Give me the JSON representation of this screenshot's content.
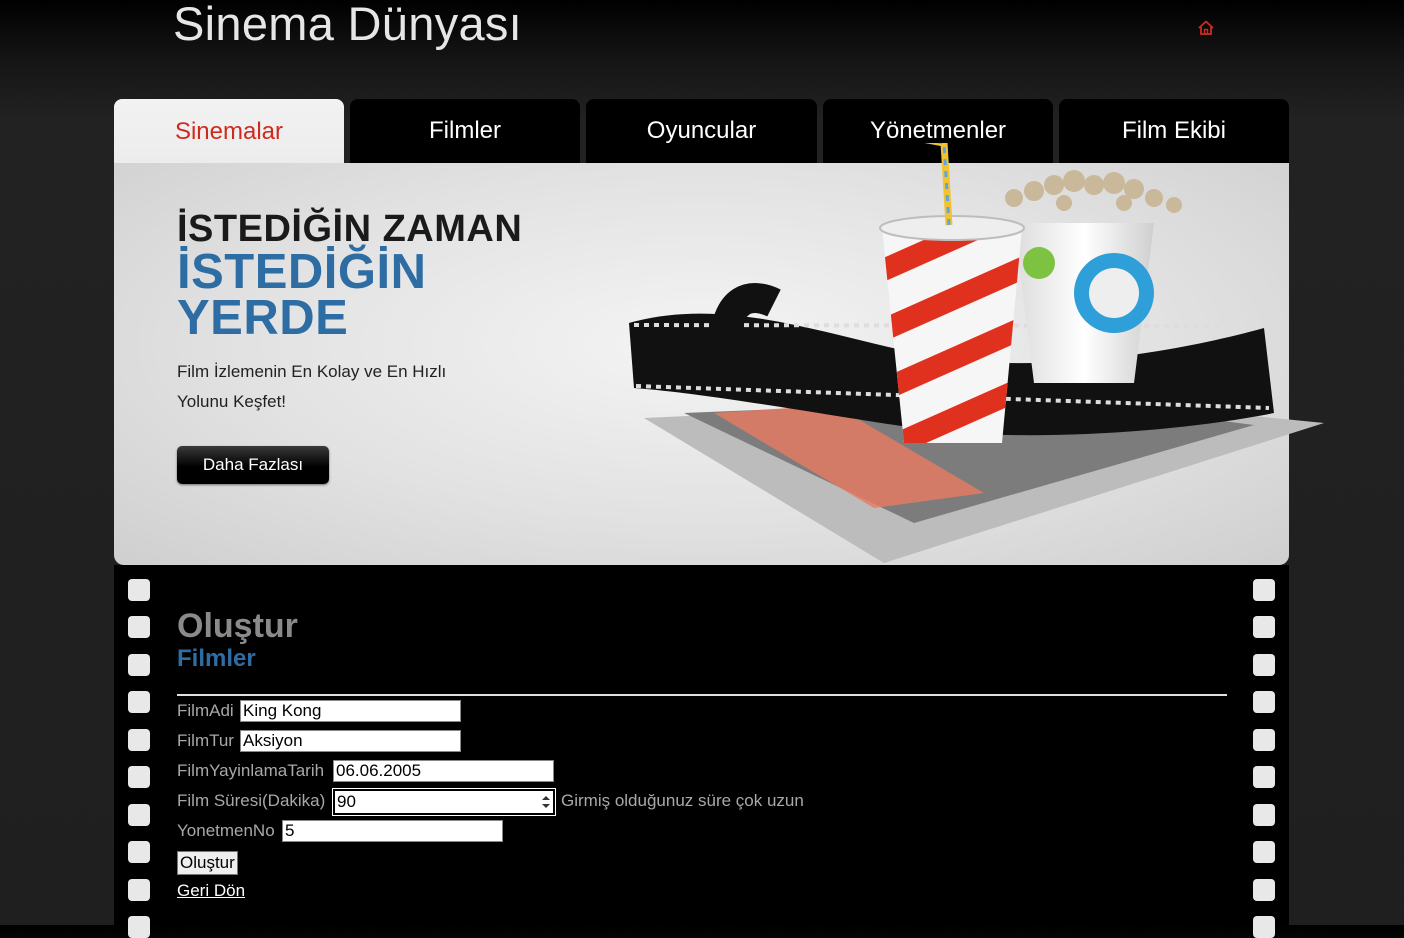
{
  "site": {
    "title": "Sinema Dünyası"
  },
  "nav": {
    "tabs": [
      {
        "label": "Sinemalar",
        "active": true
      },
      {
        "label": "Filmler"
      },
      {
        "label": "Oyuncular"
      },
      {
        "label": "Yönetmenler"
      },
      {
        "label": "Film Ekibi"
      }
    ]
  },
  "banner": {
    "line1": "İSTEDİĞİN ZAMAN",
    "line2a": "İSTEDİĞİN",
    "line2b": "YERDE",
    "description": "Film İzlemenin En Kolay ve En Hızlı Yolunu Keşfet!",
    "button": "Daha Fazlası"
  },
  "form": {
    "heading": "Oluştur",
    "subheading": "Filmler",
    "fields": [
      {
        "label": "FilmAdi",
        "value": "King Kong"
      },
      {
        "label": "FilmTur",
        "value": "Aksiyon"
      },
      {
        "label": "FilmYayinlamaTarih",
        "value": "06.06.2005"
      },
      {
        "label": "Film Süresi(Dakika)",
        "value": "90",
        "error": "Girmiş olduğunuz süre çok uzun"
      },
      {
        "label": "YonetmenNo",
        "value": "5"
      }
    ],
    "submit": "Oluştur",
    "back": "Geri Dön"
  },
  "colors": {
    "accent_red": "#d02a1e",
    "accent_blue": "#2e6da4"
  },
  "icons": {
    "home": "home-icon"
  }
}
